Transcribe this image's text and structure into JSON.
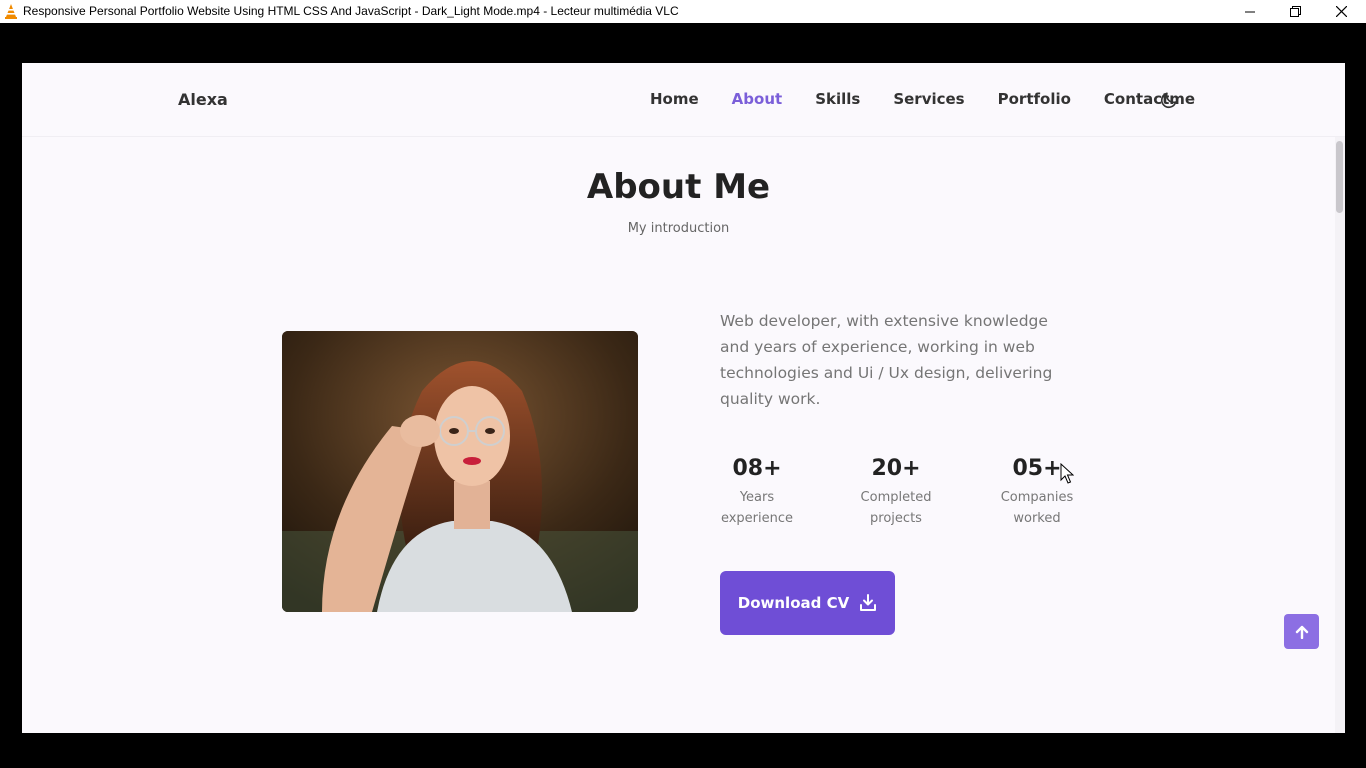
{
  "window": {
    "title": "Responsive Personal Portfolio Website Using HTML CSS And JavaScript - Dark_Light Mode.mp4 - Lecteur multimédia VLC"
  },
  "header": {
    "logo": "Alexa",
    "nav": [
      {
        "label": "Home",
        "active": false
      },
      {
        "label": "About",
        "active": true
      },
      {
        "label": "Skills",
        "active": false
      },
      {
        "label": "Services",
        "active": false
      },
      {
        "label": "Portfolio",
        "active": false
      },
      {
        "label": "Contactme",
        "active": false
      }
    ],
    "theme_icon": "moon-icon"
  },
  "about": {
    "title": "About Me",
    "subtitle": "My introduction",
    "description": "Web developer, with extensive knowledge and years of experience, working in web technologies and Ui / Ux design, delivering quality work.",
    "stats": [
      {
        "number": "08+",
        "line1": "Years",
        "line2": "experience"
      },
      {
        "number": "20+",
        "line1": "Completed",
        "line2": "projects"
      },
      {
        "number": "05+",
        "line1": "Companies",
        "line2": "worked"
      }
    ],
    "download_label": "Download CV",
    "download_icon": "download-icon"
  },
  "colors": {
    "accent": "#6f4ed6",
    "active_nav": "#7b5fd9",
    "background": "#fbf9fd"
  }
}
